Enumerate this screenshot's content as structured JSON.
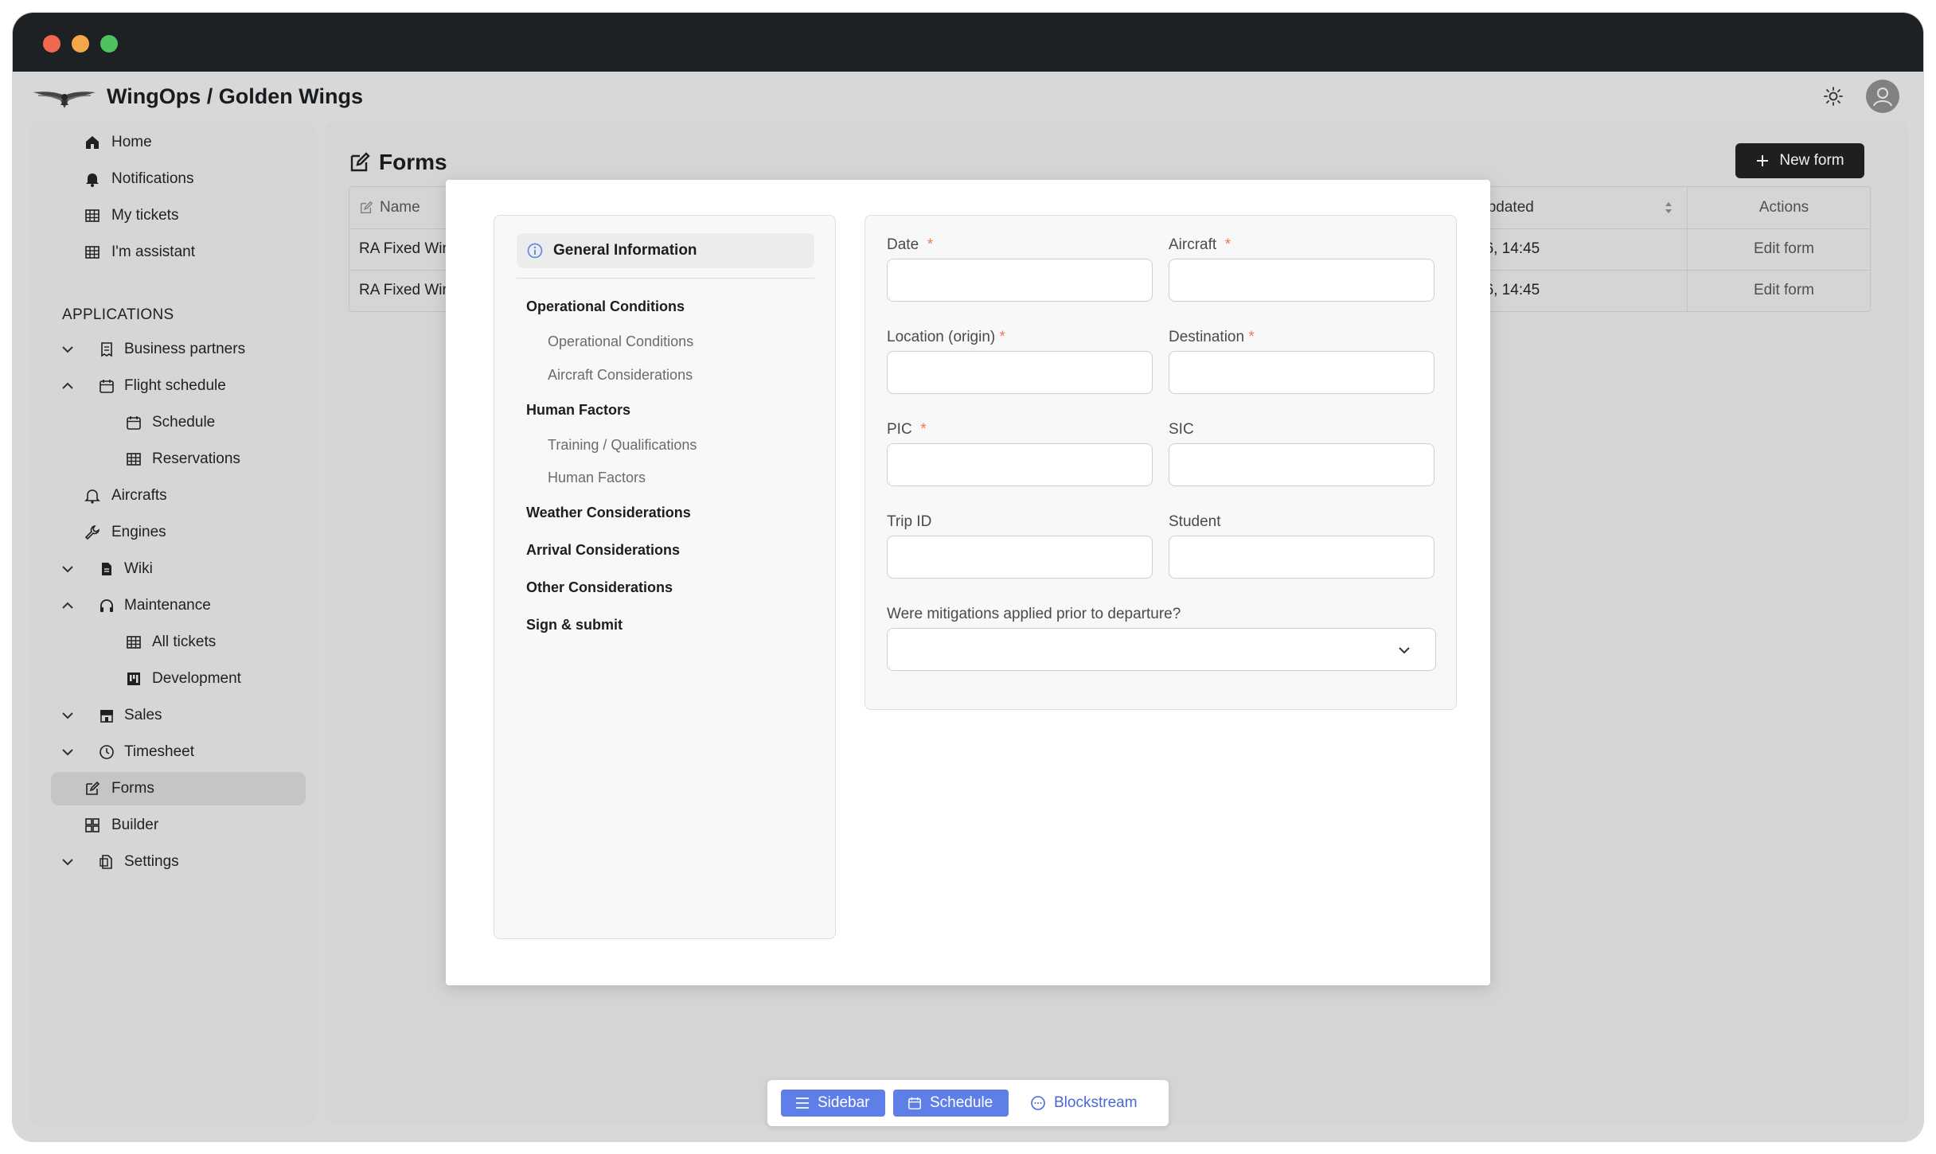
{
  "app": {
    "title": "WingOps / Golden Wings"
  },
  "sidebar": {
    "items": [
      {
        "label": "Home",
        "icon": "home-icon"
      },
      {
        "label": "Notifications",
        "icon": "bell-icon"
      },
      {
        "label": "My tickets",
        "icon": "table-icon"
      },
      {
        "label": "I'm assistant",
        "icon": "table-icon"
      }
    ],
    "section_label": "APPLICATIONS",
    "apps": [
      {
        "label": "Business partners",
        "icon": "receipt-icon",
        "expander": "down"
      },
      {
        "label": "Flight schedule",
        "icon": "calendar-icon",
        "expander": "up"
      },
      {
        "label": "Schedule",
        "icon": "calendar-icon",
        "child": true
      },
      {
        "label": "Reservations",
        "icon": "table-icon",
        "child": true
      },
      {
        "label": "Aircrafts",
        "icon": "bell-icon"
      },
      {
        "label": "Engines",
        "icon": "wrench-icon"
      },
      {
        "label": "Wiki",
        "icon": "file-icon",
        "expander": "down"
      },
      {
        "label": "Maintenance",
        "icon": "headphones-icon",
        "expander": "up"
      },
      {
        "label": "All tickets",
        "icon": "table-icon",
        "child": true
      },
      {
        "label": "Development",
        "icon": "kanban-icon",
        "child": true
      },
      {
        "label": "Sales",
        "icon": "store-icon",
        "expander": "down"
      },
      {
        "label": "Timesheet",
        "icon": "clock-icon",
        "expander": "down"
      },
      {
        "label": "Forms",
        "icon": "edit-icon",
        "active": true
      },
      {
        "label": "Builder",
        "icon": "grid-icon"
      },
      {
        "label": "Settings",
        "icon": "settings-file-icon",
        "expander": "down"
      }
    ]
  },
  "main": {
    "title": "Forms",
    "new_button": "New form",
    "table": {
      "headers": {
        "name": "Name",
        "updated": "Updated",
        "actions": "Actions"
      },
      "rows": [
        {
          "name": "RA Fixed Wing",
          "updated": "26, 14:45",
          "action": "Edit form"
        },
        {
          "name": "RA Fixed Wing",
          "updated": "26, 14:45",
          "action": "Edit form"
        }
      ]
    }
  },
  "modal": {
    "steps": {
      "active": "General Information",
      "groups": [
        {
          "label": "Operational Conditions"
        },
        {
          "label": "Operational Conditions",
          "sub": true
        },
        {
          "label": "Aircraft Considerations",
          "sub": true
        },
        {
          "label": "Human Factors"
        },
        {
          "label": "Training / Qualifications",
          "sub": true
        },
        {
          "label": "Human Factors",
          "sub": true
        },
        {
          "label": "Weather Considerations"
        },
        {
          "label": "Arrival Considerations"
        },
        {
          "label": "Other Considerations"
        },
        {
          "label": "Sign & submit"
        }
      ]
    },
    "fields": {
      "date": {
        "label": "Date",
        "required": "*",
        "value": ""
      },
      "aircraft": {
        "label": "Aircraft",
        "required": "*",
        "value": ""
      },
      "location": {
        "label": "Location (origin)",
        "required": "*",
        "value": ""
      },
      "destination": {
        "label": "Destination",
        "required": "*",
        "value": ""
      },
      "pic": {
        "label": "PIC",
        "required": "*",
        "value": ""
      },
      "sic": {
        "label": "SIC",
        "value": ""
      },
      "trip_id": {
        "label": "Trip ID",
        "value": ""
      },
      "student": {
        "label": "Student",
        "value": ""
      },
      "mitigations": {
        "label": "Were mitigations applied prior to departure?",
        "value": ""
      }
    }
  },
  "bottom_bar": {
    "sidebar": "Sidebar",
    "schedule": "Schedule",
    "blockstream": "Blockstream"
  },
  "colors": {
    "accent": "#5f7fe8",
    "required": "#f07a4a",
    "titlebar": "#1e2124"
  }
}
